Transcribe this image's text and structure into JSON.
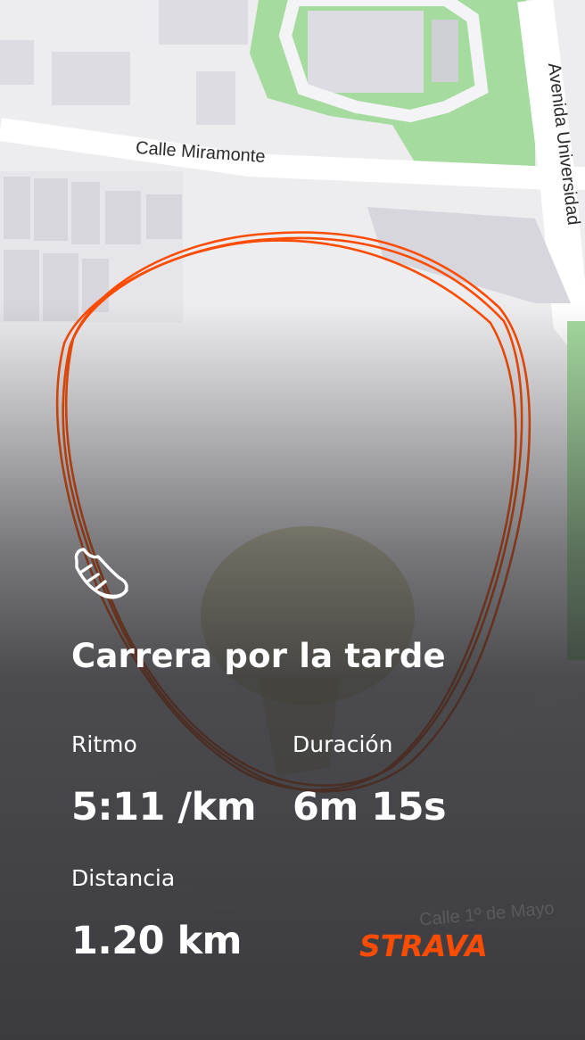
{
  "map": {
    "streets": {
      "top": "Calle Miramonte",
      "right": "Avenida Universidad",
      "bottom": "Calle 1º de Mayo"
    },
    "route_color": "#fc4c02"
  },
  "activity": {
    "icon": "running-shoe-icon",
    "title": "Carrera por la tarde"
  },
  "stats": {
    "pace_label": "Ritmo",
    "pace_value": "5:11 /km",
    "duration_label": "Duración",
    "duration_value": "6m 15s",
    "distance_label": "Distancia",
    "distance_value": "1.20 km"
  },
  "brand": {
    "name": "STRAVA",
    "color": "#fc4c02"
  }
}
